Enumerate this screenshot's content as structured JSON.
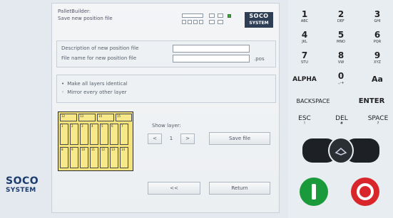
{
  "header": {
    "title": "PalletBuilder:",
    "subtitle": "Save new position file",
    "logo_top": "SOCO",
    "logo_bottom": "SYSTEM"
  },
  "form": {
    "description_label": "Description of new position file",
    "description_value": "",
    "filename_label": "File name for new position file",
    "filename_value": "",
    "filename_ext": ".pos"
  },
  "options": {
    "opt1": "Make all layers identical",
    "opt2": "Mirror every other layer",
    "selected": "opt1"
  },
  "layer": {
    "show_label": "Show layer:",
    "prev": "<",
    "value": "1",
    "next": ">"
  },
  "buttons": {
    "save": "Save file",
    "back": "<<",
    "return": "Return"
  },
  "brand": {
    "top": "SOCO",
    "bottom": "SYSTEM"
  },
  "keypad": {
    "keys": [
      {
        "big": "1",
        "small": "ABC"
      },
      {
        "big": "2",
        "small": "DEF"
      },
      {
        "big": "3",
        "small": "GHI"
      },
      {
        "big": "4",
        "small": "JKL"
      },
      {
        "big": "5",
        "small": "MNO"
      },
      {
        "big": "6",
        "small": "PQR"
      },
      {
        "big": "7",
        "small": "STU"
      },
      {
        "big": "8",
        "small": "VW"
      },
      {
        "big": "9",
        "small": "XYZ"
      }
    ],
    "alpha": "ALPHA",
    "zero": "0",
    "zero_sub": ".,-+",
    "case": "Aa",
    "backspace": "BACKSPACE",
    "enter": "ENTER",
    "esc": "ESC",
    "esc_sub": "!",
    "del": "DEL",
    "del_sub": "#",
    "space": "SPACE",
    "space_sub": "?"
  },
  "colors": {
    "accent_blue": "#1c3b6e",
    "green": "#1a9a3a",
    "red": "#d8262a",
    "grid_yellow": "#f4e27a"
  }
}
